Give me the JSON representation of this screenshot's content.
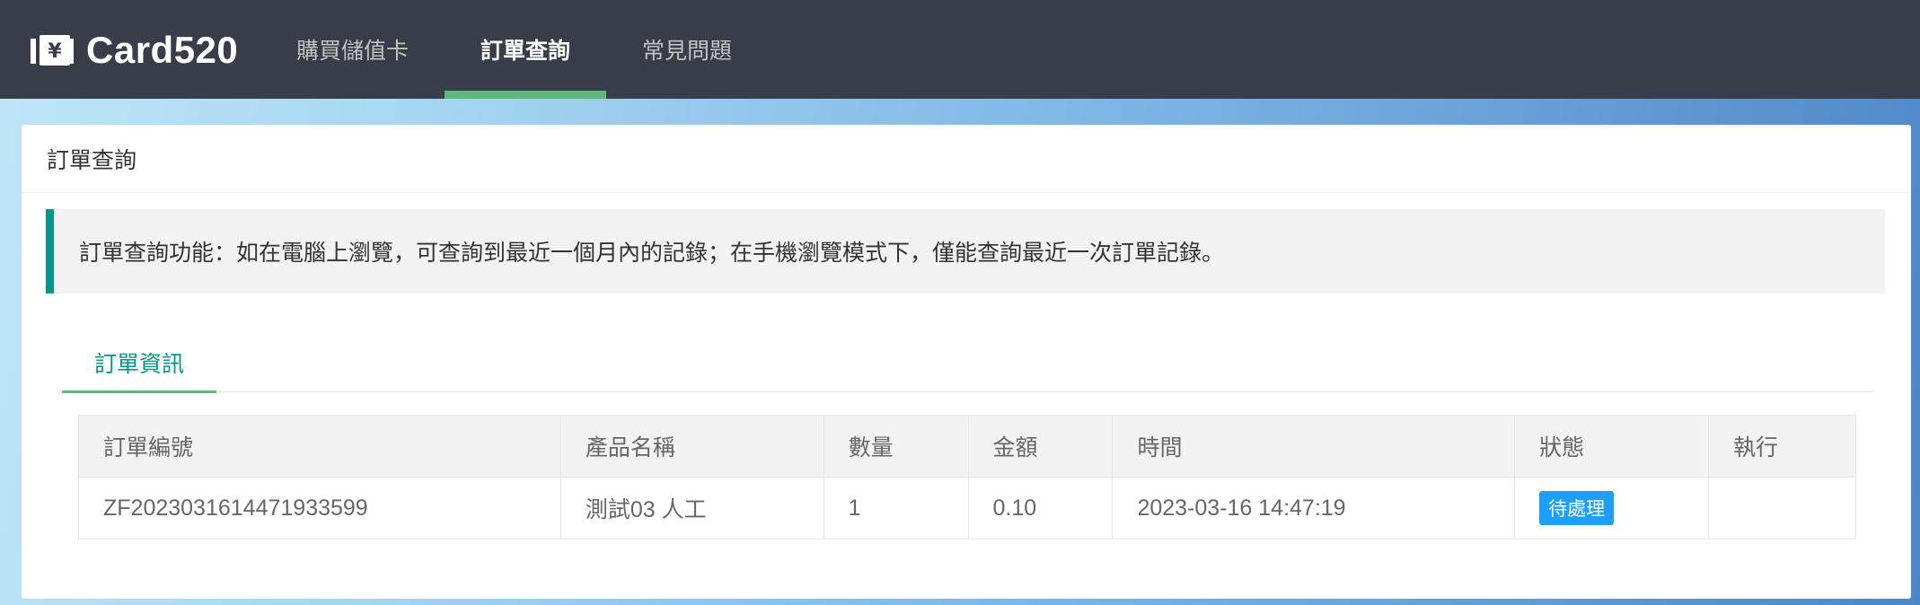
{
  "header": {
    "brand": "Card520",
    "nav": [
      {
        "label": "購買儲值卡",
        "active": false
      },
      {
        "label": "訂單查詢",
        "active": true
      },
      {
        "label": "常見問題",
        "active": false
      }
    ]
  },
  "card": {
    "title": "訂單查詢",
    "notice": "訂單查詢功能：如在電腦上瀏覽，可查詢到最近一個月內的記錄；在手機瀏覽模式下，僅能查詢最近一次訂單記錄。",
    "tab_label": "訂單資訊"
  },
  "table": {
    "columns": [
      "訂單編號",
      "產品名稱",
      "數量",
      "金額",
      "時間",
      "狀態",
      "執行"
    ],
    "rows": [
      {
        "order_no": "ZF2023031614471933599",
        "product": "測試03 人工",
        "quantity": "1",
        "amount": "0.10",
        "time": "2023-03-16 14:47:19",
        "status": "待處理",
        "action": ""
      }
    ]
  },
  "colors": {
    "header_bg": "#393d49",
    "active_underline": "#5fb878",
    "accent": "#009688",
    "status_badge": "#1e9fff"
  }
}
